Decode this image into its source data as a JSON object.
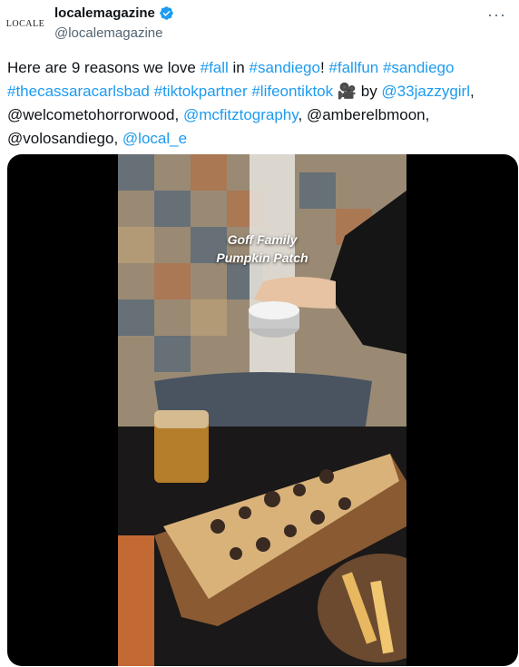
{
  "account": {
    "avatar_text": "LOCALE",
    "display_name": "localemagazine",
    "handle": "@localemagazine",
    "more_icon": "more-dots-icon"
  },
  "tweet": {
    "segments": [
      {
        "t": "Here are 9 reasons we love ",
        "link": false
      },
      {
        "t": "#fall",
        "link": true
      },
      {
        "t": " in ",
        "link": false
      },
      {
        "t": "#sandiego",
        "link": true
      },
      {
        "t": "! ",
        "link": false
      },
      {
        "t": "#fallfun",
        "link": true
      },
      {
        "t": " ",
        "link": false
      },
      {
        "t": "#sandiego",
        "link": true
      },
      {
        "t": " ",
        "link": false
      },
      {
        "t": "#thecassaracarlsbad",
        "link": true
      },
      {
        "t": " ",
        "link": false
      },
      {
        "t": "#tiktokpartner",
        "link": true
      },
      {
        "t": " ",
        "link": false
      },
      {
        "t": "#lifeontiktok",
        "link": true
      },
      {
        "t": "  🎥 by ",
        "link": false
      },
      {
        "t": "@33jazzygirl",
        "link": true
      },
      {
        "t": ", @welcometohorrorwood, ",
        "link": false
      },
      {
        "t": "@mcfitztography",
        "link": true
      },
      {
        "t": ", @amberelbmoon, @volosandiego, ",
        "link": false
      },
      {
        "t": "@local_e",
        "link": true
      }
    ]
  },
  "media": {
    "overlay_line1": "Goff Family",
    "overlay_line2": "Pumpkin Patch"
  },
  "colors": {
    "link": "#1d9bf0",
    "verified": "#1d9bf0",
    "secondary_text": "#536471"
  }
}
